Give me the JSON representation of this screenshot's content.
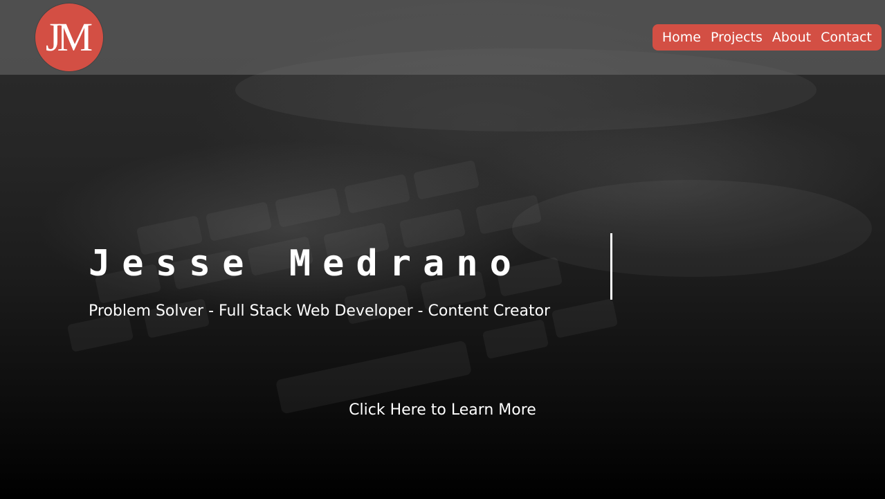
{
  "logo": {
    "text": "JM"
  },
  "nav": {
    "items": [
      {
        "label": "Home"
      },
      {
        "label": "Projects"
      },
      {
        "label": "About"
      },
      {
        "label": "Contact"
      }
    ]
  },
  "hero": {
    "name": "Jesse Medrano",
    "tagline": "Problem Solver - Full Stack Web Developer - Content Creator",
    "cta": "Click Here to Learn More"
  },
  "colors": {
    "accent": "#d34f44",
    "text": "#ffffff",
    "background": "#1c1c1c"
  }
}
